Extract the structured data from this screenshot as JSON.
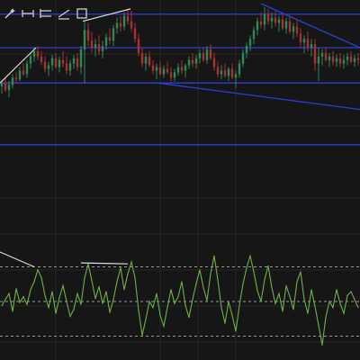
{
  "toolbar": {
    "tools": [
      {
        "name": "magic-wand-icon"
      },
      {
        "name": "horizontal-line-tool-icon"
      },
      {
        "name": "horizontal-channel-tool-icon"
      },
      {
        "name": "extended-line-tool-icon"
      },
      {
        "name": "rectangle-tool-icon"
      }
    ]
  },
  "colors": {
    "background": "#161616",
    "grid": "#262626",
    "candle_up": "#2e8b57",
    "candle_down": "#a83232",
    "level_line": "#2c3fd6",
    "trend_line": "#2c3fd6",
    "annotation_line": "#dcdcdc",
    "oscillator": "#6fb04a",
    "oscillator_band": "#9a9a9a"
  },
  "chart_data": [
    {
      "type": "candlestick",
      "title": "",
      "xlabel": "",
      "ylabel": "",
      "grid": true,
      "ylim": [
        0,
        100
      ],
      "horizontal_levels": [
        94,
        75,
        55,
        20
      ],
      "trend_lines": [
        {
          "from": [
            290,
            100
          ],
          "to": [
            400,
            75
          ]
        },
        {
          "from": [
            175,
            55
          ],
          "to": [
            400,
            40
          ]
        }
      ],
      "annotation_lines": [
        {
          "from": [
            0,
            55
          ],
          "to": [
            40,
            75
          ]
        },
        {
          "from": [
            92,
            90
          ],
          "to": [
            145,
            97
          ]
        }
      ],
      "series": [
        {
          "values": [
            {
              "t": 0,
              "o": 53,
              "h": 56,
              "l": 49,
              "c": 55
            },
            {
              "t": 4,
              "o": 55,
              "h": 58,
              "l": 50,
              "c": 51
            },
            {
              "t": 8,
              "o": 51,
              "h": 56,
              "l": 47,
              "c": 54
            },
            {
              "t": 12,
              "o": 54,
              "h": 60,
              "l": 52,
              "c": 58
            },
            {
              "t": 16,
              "o": 58,
              "h": 61,
              "l": 55,
              "c": 57
            },
            {
              "t": 20,
              "o": 57,
              "h": 64,
              "l": 56,
              "c": 62
            },
            {
              "t": 24,
              "o": 62,
              "h": 66,
              "l": 59,
              "c": 60
            },
            {
              "t": 28,
              "o": 60,
              "h": 68,
              "l": 58,
              "c": 66
            },
            {
              "t": 32,
              "o": 66,
              "h": 72,
              "l": 63,
              "c": 70
            },
            {
              "t": 36,
              "o": 70,
              "h": 75,
              "l": 67,
              "c": 73
            },
            {
              "t": 40,
              "o": 73,
              "h": 76,
              "l": 68,
              "c": 70
            },
            {
              "t": 44,
              "o": 70,
              "h": 73,
              "l": 65,
              "c": 67
            },
            {
              "t": 48,
              "o": 67,
              "h": 70,
              "l": 61,
              "c": 63
            },
            {
              "t": 52,
              "o": 63,
              "h": 67,
              "l": 59,
              "c": 65
            },
            {
              "t": 56,
              "o": 65,
              "h": 71,
              "l": 62,
              "c": 69
            },
            {
              "t": 60,
              "o": 69,
              "h": 72,
              "l": 63,
              "c": 64
            },
            {
              "t": 64,
              "o": 64,
              "h": 70,
              "l": 61,
              "c": 68
            },
            {
              "t": 68,
              "o": 68,
              "h": 73,
              "l": 64,
              "c": 66
            },
            {
              "t": 72,
              "o": 66,
              "h": 70,
              "l": 60,
              "c": 62
            },
            {
              "t": 76,
              "o": 62,
              "h": 68,
              "l": 59,
              "c": 66
            },
            {
              "t": 80,
              "o": 66,
              "h": 71,
              "l": 63,
              "c": 69
            },
            {
              "t": 84,
              "o": 69,
              "h": 72,
              "l": 62,
              "c": 64
            },
            {
              "t": 88,
              "o": 64,
              "h": 76,
              "l": 60,
              "c": 74
            },
            {
              "t": 92,
              "o": 74,
              "h": 90,
              "l": 55,
              "c": 85
            },
            {
              "t": 96,
              "o": 85,
              "h": 89,
              "l": 76,
              "c": 79
            },
            {
              "t": 100,
              "o": 79,
              "h": 84,
              "l": 72,
              "c": 75
            },
            {
              "t": 104,
              "o": 75,
              "h": 80,
              "l": 70,
              "c": 77
            },
            {
              "t": 108,
              "o": 77,
              "h": 82,
              "l": 71,
              "c": 73
            },
            {
              "t": 112,
              "o": 73,
              "h": 79,
              "l": 69,
              "c": 76
            },
            {
              "t": 116,
              "o": 76,
              "h": 83,
              "l": 74,
              "c": 81
            },
            {
              "t": 120,
              "o": 81,
              "h": 86,
              "l": 77,
              "c": 79
            },
            {
              "t": 124,
              "o": 79,
              "h": 88,
              "l": 76,
              "c": 86
            },
            {
              "t": 128,
              "o": 86,
              "h": 92,
              "l": 83,
              "c": 89
            },
            {
              "t": 132,
              "o": 89,
              "h": 93,
              "l": 84,
              "c": 87
            },
            {
              "t": 136,
              "o": 87,
              "h": 95,
              "l": 85,
              "c": 93
            },
            {
              "t": 140,
              "o": 93,
              "h": 97,
              "l": 88,
              "c": 90
            },
            {
              "t": 144,
              "o": 90,
              "h": 96,
              "l": 84,
              "c": 86
            },
            {
              "t": 148,
              "o": 86,
              "h": 89,
              "l": 78,
              "c": 80
            },
            {
              "t": 152,
              "o": 80,
              "h": 83,
              "l": 70,
              "c": 72
            },
            {
              "t": 156,
              "o": 72,
              "h": 75,
              "l": 64,
              "c": 66
            },
            {
              "t": 160,
              "o": 66,
              "h": 72,
              "l": 62,
              "c": 70
            },
            {
              "t": 164,
              "o": 70,
              "h": 73,
              "l": 64,
              "c": 65
            },
            {
              "t": 168,
              "o": 65,
              "h": 68,
              "l": 60,
              "c": 62
            },
            {
              "t": 172,
              "o": 62,
              "h": 66,
              "l": 57,
              "c": 64
            },
            {
              "t": 176,
              "o": 64,
              "h": 67,
              "l": 59,
              "c": 60
            },
            {
              "t": 180,
              "o": 60,
              "h": 65,
              "l": 58,
              "c": 63
            },
            {
              "t": 184,
              "o": 63,
              "h": 67,
              "l": 60,
              "c": 61
            },
            {
              "t": 188,
              "o": 61,
              "h": 64,
              "l": 56,
              "c": 58
            },
            {
              "t": 192,
              "o": 58,
              "h": 63,
              "l": 56,
              "c": 61
            },
            {
              "t": 196,
              "o": 61,
              "h": 66,
              "l": 59,
              "c": 64
            },
            {
              "t": 200,
              "o": 64,
              "h": 68,
              "l": 60,
              "c": 62
            },
            {
              "t": 204,
              "o": 62,
              "h": 66,
              "l": 58,
              "c": 65
            },
            {
              "t": 208,
              "o": 65,
              "h": 70,
              "l": 63,
              "c": 68
            },
            {
              "t": 212,
              "o": 68,
              "h": 72,
              "l": 64,
              "c": 66
            },
            {
              "t": 216,
              "o": 66,
              "h": 71,
              "l": 63,
              "c": 69
            },
            {
              "t": 220,
              "o": 69,
              "h": 74,
              "l": 66,
              "c": 72
            },
            {
              "t": 224,
              "o": 72,
              "h": 75,
              "l": 67,
              "c": 68
            },
            {
              "t": 228,
              "o": 68,
              "h": 76,
              "l": 66,
              "c": 74
            },
            {
              "t": 232,
              "o": 74,
              "h": 77,
              "l": 68,
              "c": 69
            },
            {
              "t": 236,
              "o": 69,
              "h": 72,
              "l": 62,
              "c": 64
            },
            {
              "t": 240,
              "o": 64,
              "h": 67,
              "l": 58,
              "c": 60
            },
            {
              "t": 244,
              "o": 60,
              "h": 65,
              "l": 57,
              "c": 62
            },
            {
              "t": 248,
              "o": 62,
              "h": 66,
              "l": 58,
              "c": 59
            },
            {
              "t": 252,
              "o": 59,
              "h": 64,
              "l": 56,
              "c": 63
            },
            {
              "t": 256,
              "o": 63,
              "h": 66,
              "l": 57,
              "c": 58
            },
            {
              "t": 260,
              "o": 58,
              "h": 62,
              "l": 52,
              "c": 60
            },
            {
              "t": 264,
              "o": 60,
              "h": 68,
              "l": 58,
              "c": 66
            },
            {
              "t": 268,
              "o": 66,
              "h": 74,
              "l": 64,
              "c": 72
            },
            {
              "t": 272,
              "o": 72,
              "h": 78,
              "l": 69,
              "c": 76
            },
            {
              "t": 276,
              "o": 76,
              "h": 82,
              "l": 73,
              "c": 80
            },
            {
              "t": 280,
              "o": 80,
              "h": 87,
              "l": 77,
              "c": 85
            },
            {
              "t": 284,
              "o": 85,
              "h": 92,
              "l": 82,
              "c": 90
            },
            {
              "t": 288,
              "o": 90,
              "h": 95,
              "l": 86,
              "c": 88
            },
            {
              "t": 292,
              "o": 88,
              "h": 98,
              "l": 85,
              "c": 94
            },
            {
              "t": 296,
              "o": 94,
              "h": 97,
              "l": 88,
              "c": 90
            },
            {
              "t": 300,
              "o": 90,
              "h": 95,
              "l": 86,
              "c": 92
            },
            {
              "t": 304,
              "o": 92,
              "h": 96,
              "l": 87,
              "c": 89
            },
            {
              "t": 308,
              "o": 89,
              "h": 93,
              "l": 84,
              "c": 91
            },
            {
              "t": 312,
              "o": 91,
              "h": 94,
              "l": 85,
              "c": 86
            },
            {
              "t": 316,
              "o": 86,
              "h": 92,
              "l": 83,
              "c": 90
            },
            {
              "t": 320,
              "o": 90,
              "h": 93,
              "l": 83,
              "c": 84
            },
            {
              "t": 324,
              "o": 84,
              "h": 89,
              "l": 80,
              "c": 87
            },
            {
              "t": 328,
              "o": 87,
              "h": 91,
              "l": 81,
              "c": 83
            },
            {
              "t": 332,
              "o": 83,
              "h": 86,
              "l": 75,
              "c": 78
            },
            {
              "t": 336,
              "o": 78,
              "h": 82,
              "l": 72,
              "c": 80
            },
            {
              "t": 340,
              "o": 80,
              "h": 84,
              "l": 73,
              "c": 75
            },
            {
              "t": 344,
              "o": 75,
              "h": 80,
              "l": 70,
              "c": 77
            },
            {
              "t": 348,
              "o": 77,
              "h": 80,
              "l": 62,
              "c": 66
            },
            {
              "t": 352,
              "o": 66,
              "h": 75,
              "l": 56,
              "c": 70
            },
            {
              "t": 356,
              "o": 70,
              "h": 74,
              "l": 65,
              "c": 72
            },
            {
              "t": 360,
              "o": 72,
              "h": 75,
              "l": 67,
              "c": 68
            },
            {
              "t": 364,
              "o": 68,
              "h": 72,
              "l": 64,
              "c": 70
            },
            {
              "t": 368,
              "o": 70,
              "h": 73,
              "l": 65,
              "c": 67
            },
            {
              "t": 372,
              "o": 67,
              "h": 71,
              "l": 64,
              "c": 69
            },
            {
              "t": 376,
              "o": 69,
              "h": 72,
              "l": 64,
              "c": 66
            },
            {
              "t": 380,
              "o": 66,
              "h": 71,
              "l": 63,
              "c": 68
            },
            {
              "t": 384,
              "o": 68,
              "h": 72,
              "l": 65,
              "c": 70
            },
            {
              "t": 388,
              "o": 70,
              "h": 73,
              "l": 66,
              "c": 67
            },
            {
              "t": 392,
              "o": 67,
              "h": 71,
              "l": 64,
              "c": 69
            },
            {
              "t": 396,
              "o": 69,
              "h": 72,
              "l": 65,
              "c": 68
            }
          ]
        }
      ]
    },
    {
      "type": "line",
      "title": "",
      "xlabel": "",
      "ylabel": "",
      "grid": true,
      "ylim": [
        0,
        100
      ],
      "bands": [
        85,
        50,
        15
      ],
      "annotation_lines": [
        {
          "from": [
            0,
            100
          ],
          "to": [
            38,
            85
          ]
        },
        {
          "from": [
            90,
            89
          ],
          "to": [
            142,
            88
          ]
        }
      ],
      "series": [
        {
          "x": [
            0,
            4,
            8,
            12,
            16,
            20,
            24,
            28,
            32,
            36,
            40,
            44,
            48,
            52,
            56,
            60,
            64,
            68,
            72,
            76,
            80,
            84,
            88,
            92,
            96,
            100,
            104,
            108,
            112,
            116,
            120,
            124,
            128,
            132,
            136,
            140,
            144,
            148,
            152,
            156,
            160,
            164,
            168,
            172,
            176,
            180,
            184,
            188,
            192,
            196,
            200,
            204,
            208,
            212,
            216,
            220,
            224,
            228,
            232,
            236,
            240,
            244,
            248,
            252,
            256,
            260,
            264,
            268,
            272,
            276,
            280,
            284,
            288,
            292,
            296,
            300,
            304,
            308,
            312,
            316,
            320,
            324,
            328,
            332,
            336,
            340,
            344,
            348,
            352,
            356,
            360,
            364,
            368,
            372,
            376,
            380,
            384,
            388,
            392,
            396
          ],
          "values": [
            46,
            52,
            58,
            40,
            63,
            49,
            55,
            47,
            62,
            70,
            82,
            74,
            56,
            44,
            60,
            38,
            54,
            66,
            50,
            35,
            42,
            58,
            47,
            74,
            88,
            71,
            53,
            65,
            48,
            60,
            39,
            52,
            70,
            84,
            62,
            78,
            90,
            74,
            41,
            16,
            32,
            50,
            44,
            58,
            36,
            25,
            44,
            62,
            48,
            55,
            70,
            46,
            34,
            52,
            68,
            82,
            64,
            51,
            78,
            96,
            72,
            44,
            28,
            50,
            36,
            20,
            46,
            68,
            84,
            96,
            80,
            61,
            50,
            72,
            86,
            64,
            48,
            58,
            40,
            66,
            55,
            42,
            70,
            80,
            52,
            38,
            62,
            45,
            26,
            6,
            34,
            50,
            44,
            62,
            48,
            38,
            56,
            60,
            52,
            44
          ]
        }
      ]
    }
  ]
}
